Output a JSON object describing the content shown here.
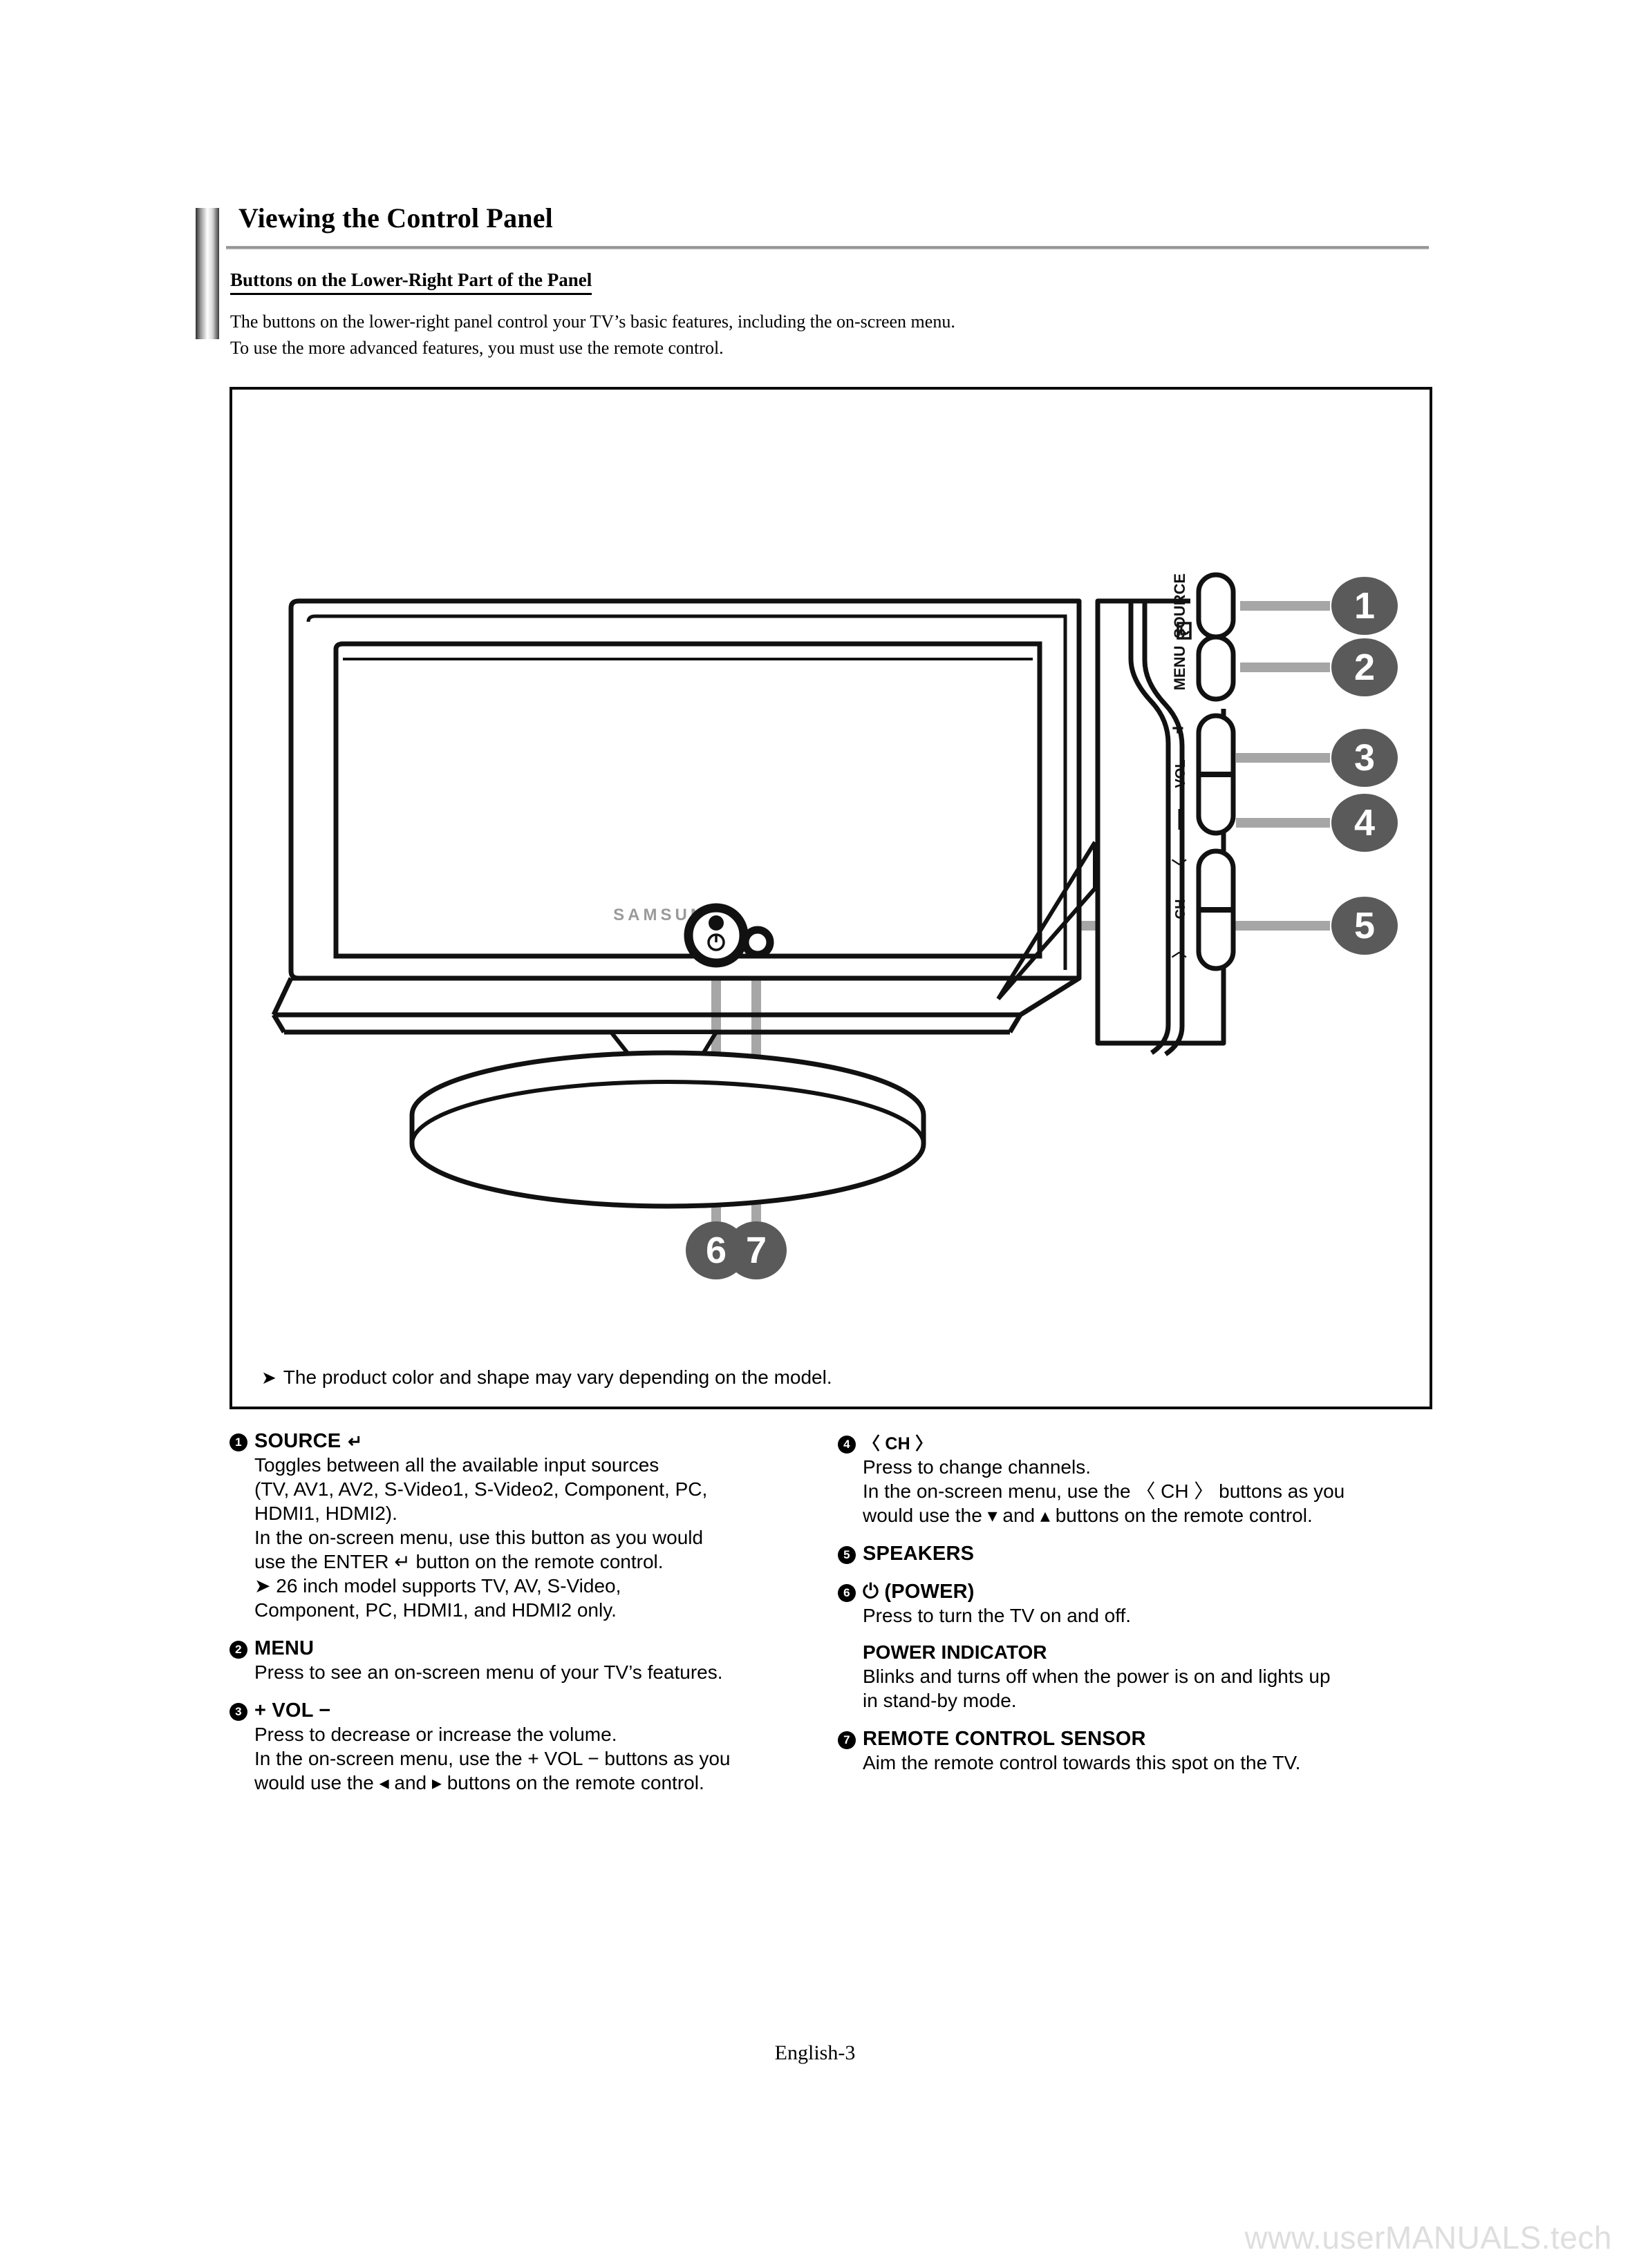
{
  "header": {
    "title": "Viewing the Control Panel",
    "subtitle": "Buttons on the Lower-Right Part of the Panel",
    "intro_line1": "The buttons on the lower-right panel control your TV’s basic features, including the on-screen menu.",
    "intro_line2": "To use the more advanced features, you must use the remote control."
  },
  "figure": {
    "note": "The product color and shape may vary depending on the model.",
    "note_marker": "➤",
    "brand": "SAMSUNG",
    "panel_labels": {
      "source": "SOURCE",
      "source_icon": "enter-icon",
      "menu": "MENU",
      "vol_plus": "+",
      "vol": "VOL",
      "vol_minus": "−",
      "ch_left": "〈",
      "ch": "CH",
      "ch_right": "〉"
    },
    "callouts": [
      {
        "n": "1",
        "target": "source-button"
      },
      {
        "n": "2",
        "target": "menu-button"
      },
      {
        "n": "3",
        "target": "volume-rocker"
      },
      {
        "n": "4",
        "target": "channel-rocker"
      },
      {
        "n": "5",
        "target": "speakers"
      },
      {
        "n": "6",
        "target": "power-button"
      },
      {
        "n": "7",
        "target": "remote-control-sensor"
      }
    ],
    "callout_circle_color": "#5a5a5a",
    "callout_line_color": "#a6a6a6",
    "callout_number_color": "#ffffff"
  },
  "legend": {
    "left": [
      {
        "num": "1",
        "title": "SOURCE",
        "title_icon": "↵",
        "lines": [
          "Toggles between all the available input sources",
          "(TV, AV1, AV2, S-Video1, S-Video2, Component, PC,",
          "HDMI1, HDMI2).",
          "In the on-screen menu, use this button as you would",
          "use the ENTER ↵ button on the remote control."
        ],
        "sub_marker": "➤",
        "sub_lines": [
          "26 inch model supports TV, AV, S-Video,",
          "Component, PC, HDMI1, and HDMI2 only."
        ]
      },
      {
        "num": "2",
        "title": "MENU",
        "lines": [
          "Press to see an on-screen menu of your TV’s features."
        ]
      },
      {
        "num": "3",
        "title": "+ VOL −",
        "lines": [
          "Press to decrease or increase the volume.",
          "In the on-screen menu, use the + VOL −  buttons as you",
          "would use the ◂  and  ▸ buttons on the remote control."
        ]
      }
    ],
    "right": [
      {
        "num": "4",
        "title": "〈 CH 〉",
        "lines": [
          "Press to change channels.",
          "In the on-screen menu, use the 〈 CH 〉 buttons as you",
          "would use the ▾ and ▴ buttons on the remote control."
        ]
      },
      {
        "num": "5",
        "title": "SPEAKERS",
        "lines": []
      },
      {
        "num": "6",
        "title": "⏻ (POWER)",
        "lines": [
          "Press to turn the TV on and off."
        ],
        "sub_title": "POWER INDICATOR",
        "sub_body": [
          "Blinks and turns off when the power is on and lights up",
          "in stand-by mode."
        ]
      },
      {
        "num": "7",
        "title": "REMOTE CONTROL SENSOR",
        "lines": [
          "Aim the remote control towards this spot on the TV."
        ]
      }
    ]
  },
  "footer": {
    "page_label": "English-3"
  },
  "watermark": {
    "text": "www.userMANUALS.tech"
  }
}
